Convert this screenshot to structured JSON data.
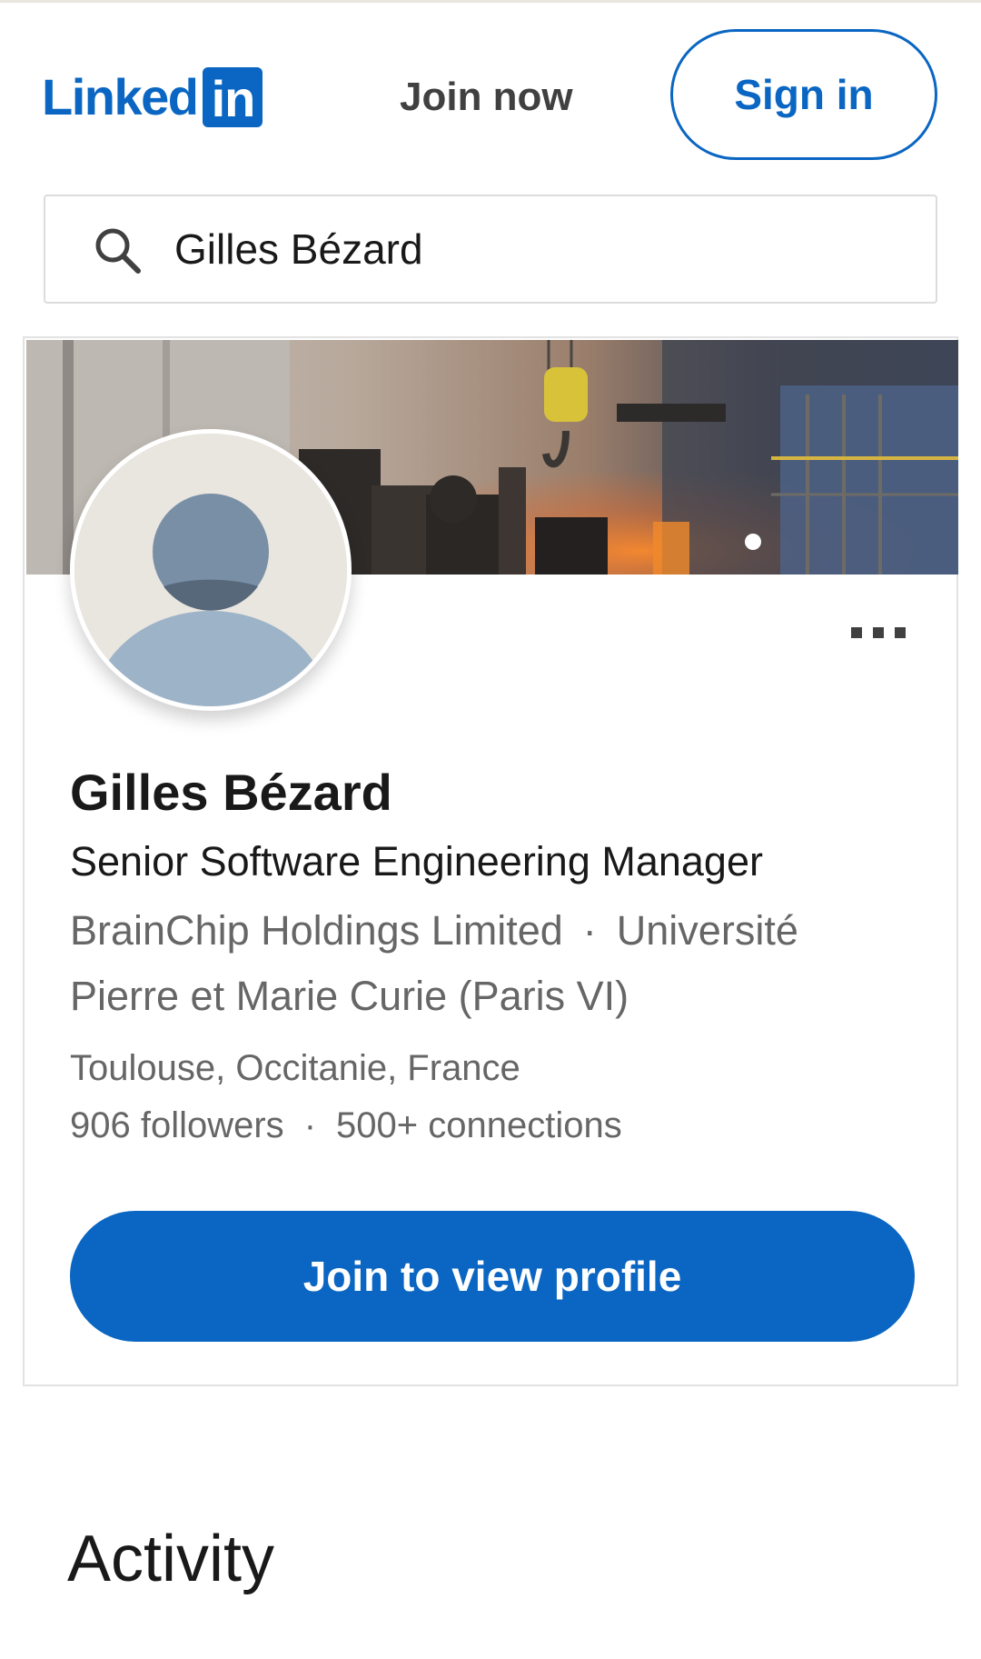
{
  "header": {
    "logo_text": "Linked",
    "logo_box": "in",
    "join_now": "Join now",
    "sign_in": "Sign in"
  },
  "search": {
    "value": "Gilles Bézard",
    "icon": "search-icon"
  },
  "profile": {
    "name": "Gilles Bézard",
    "headline": "Senior Software Engineering Manager",
    "company": "BrainChip Holdings Limited",
    "school": "Université Pierre et Marie Curie (Paris VI)",
    "location": "Toulouse, Occitanie, France",
    "followers": "906 followers",
    "connections": "500+ connections",
    "separator": "·",
    "join_button": "Join to view profile",
    "more_icon": "more-dots-icon"
  },
  "activity": {
    "title": "Activity"
  },
  "colors": {
    "brand": "#0a66c2",
    "text_primary": "#191919",
    "text_secondary": "#666666",
    "border": "#e2e2e2",
    "avatar_bg": "#e9e5df"
  }
}
